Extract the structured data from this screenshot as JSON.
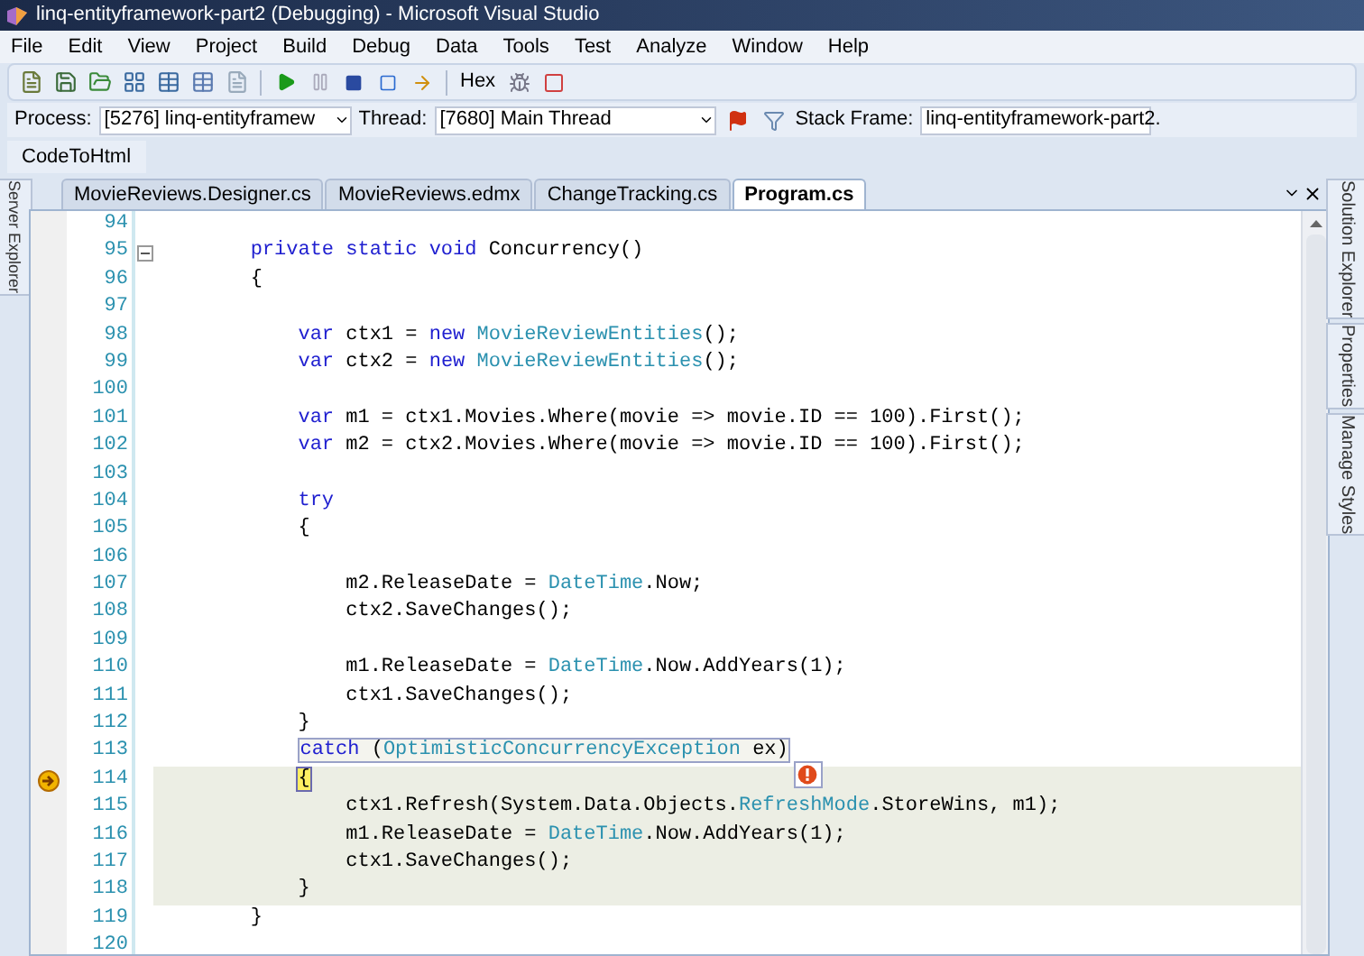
{
  "window": {
    "title": "linq-entityframework-part2 (Debugging) - Microsoft Visual Studio"
  },
  "menu": [
    "File",
    "Edit",
    "View",
    "Project",
    "Build",
    "Debug",
    "Data",
    "Tools",
    "Test",
    "Analyze",
    "Window",
    "Help"
  ],
  "toolbar": {
    "hex_button": "Hex"
  },
  "debug_bar": {
    "process_label": "Process:",
    "process": "[5276] linq-entityframew",
    "thread_label": "Thread:",
    "thread": "[7680] Main Thread",
    "stack_frame_label": "Stack Frame:",
    "stack_frame": "linq-entityframework-part2."
  },
  "code_to_html_bar": {
    "label": "CodeToHtml"
  },
  "left_dock": [
    "Server Explorer"
  ],
  "tabs": [
    {
      "label": "MovieReviews.Designer.cs",
      "selected": false
    },
    {
      "label": "MovieReviews.edmx",
      "selected": false
    },
    {
      "label": "ChangeTracking.cs",
      "selected": false
    },
    {
      "label": "Program.cs",
      "selected": true
    }
  ],
  "right_dock": [
    "Solution Explorer",
    "Properties",
    "Manage Styles"
  ],
  "editor": {
    "lines": [
      {
        "number": "94"
      },
      {
        "number": "95",
        "highlighted": false,
        "current": false,
        "collapsible": true,
        "boxed": false,
        "tokens": [
          {
            "text": "        private static void",
            "kind": "keyword"
          },
          {
            "text": " Concurrency()",
            "kind": "plain"
          }
        ]
      },
      {
        "number": "96",
        "highlighted": false,
        "current": false,
        "collapsible": false,
        "boxed": false,
        "tokens": [
          {
            "text": "        {",
            "kind": "plain"
          }
        ]
      },
      {
        "number": "97"
      },
      {
        "number": "98",
        "highlighted": false,
        "current": false,
        "collapsible": false,
        "boxed": false,
        "tokens": [
          {
            "text": "            var",
            "kind": "keyword"
          },
          {
            "text": " ctx1 = ",
            "kind": "plain"
          },
          {
            "text": "new",
            "kind": "keyword"
          },
          {
            "text": " MovieReviewEntities",
            "kind": "type"
          },
          {
            "text": "();",
            "kind": "plain"
          }
        ]
      },
      {
        "number": "99",
        "highlighted": false,
        "current": false,
        "collapsible": false,
        "boxed": false,
        "tokens": [
          {
            "text": "            var",
            "kind": "keyword"
          },
          {
            "text": " ctx2 = ",
            "kind": "plain"
          },
          {
            "text": "new",
            "kind": "keyword"
          },
          {
            "text": " MovieReviewEntities",
            "kind": "type"
          },
          {
            "text": "();",
            "kind": "plain"
          }
        ]
      },
      {
        "number": "100"
      },
      {
        "number": "101",
        "highlighted": false,
        "current": false,
        "collapsible": false,
        "boxed": false,
        "tokens": [
          {
            "text": "            var",
            "kind": "keyword"
          },
          {
            "text": " m1 = ctx1.Movies.Where(movie => movie.ID == 100).First();",
            "kind": "plain"
          }
        ]
      },
      {
        "number": "102",
        "highlighted": false,
        "current": false,
        "collapsible": false,
        "boxed": false,
        "tokens": [
          {
            "text": "            var",
            "kind": "keyword"
          },
          {
            "text": " m2 = ctx2.Movies.Where(movie => movie.ID == 100).First();",
            "kind": "plain"
          }
        ]
      },
      {
        "number": "103"
      },
      {
        "number": "104",
        "highlighted": false,
        "current": false,
        "collapsible": false,
        "boxed": false,
        "tokens": [
          {
            "text": "            try",
            "kind": "keyword"
          }
        ]
      },
      {
        "number": "105",
        "highlighted": false,
        "current": false,
        "collapsible": false,
        "boxed": false,
        "tokens": [
          {
            "text": "            {",
            "kind": "plain"
          }
        ]
      },
      {
        "number": "106"
      },
      {
        "number": "107",
        "highlighted": false,
        "current": false,
        "collapsible": false,
        "boxed": false,
        "tokens": [
          {
            "text": "                m2.ReleaseDate = ",
            "kind": "plain"
          },
          {
            "text": "DateTime",
            "kind": "type"
          },
          {
            "text": ".Now;",
            "kind": "plain"
          }
        ]
      },
      {
        "number": "108",
        "highlighted": false,
        "current": false,
        "collapsible": false,
        "boxed": false,
        "tokens": [
          {
            "text": "                ctx2.SaveChanges();",
            "kind": "plain"
          }
        ]
      },
      {
        "number": "109"
      },
      {
        "number": "110",
        "highlighted": false,
        "current": false,
        "collapsible": false,
        "boxed": false,
        "tokens": [
          {
            "text": "                m1.ReleaseDate = ",
            "kind": "plain"
          },
          {
            "text": "DateTime",
            "kind": "type"
          },
          {
            "text": ".Now.AddYears(1);",
            "kind": "plain"
          }
        ]
      },
      {
        "number": "111",
        "highlighted": false,
        "current": false,
        "collapsible": false,
        "boxed": false,
        "tokens": [
          {
            "text": "                ctx1.SaveChanges();",
            "kind": "plain"
          }
        ]
      },
      {
        "number": "112",
        "highlighted": false,
        "current": false,
        "collapsible": false,
        "boxed": false,
        "tokens": [
          {
            "text": "            }",
            "kind": "plain"
          }
        ]
      },
      {
        "number": "113",
        "highlighted": false,
        "current": false,
        "collapsible": false,
        "boxed": true,
        "tokens": [
          {
            "text": "            catch",
            "kind": "keyword"
          },
          {
            "text": " (",
            "kind": "plain"
          },
          {
            "text": "OptimisticConcurrencyException",
            "kind": "type"
          },
          {
            "text": " ex)",
            "kind": "plain"
          }
        ]
      },
      {
        "number": "114",
        "highlighted": true,
        "current": true,
        "collapsible": false,
        "boxed": false,
        "tokens": [
          {
            "text": "            {",
            "kind": "plain"
          }
        ]
      },
      {
        "number": "115",
        "highlighted": true,
        "current": false,
        "collapsible": false,
        "boxed": false,
        "tokens": [
          {
            "text": "                ctx1.Refresh(System.Data.Objects.",
            "kind": "plain"
          },
          {
            "text": "RefreshMode",
            "kind": "type"
          },
          {
            "text": ".StoreWins, m1);",
            "kind": "plain"
          }
        ]
      },
      {
        "number": "116",
        "highlighted": true,
        "current": false,
        "collapsible": false,
        "boxed": false,
        "tokens": [
          {
            "text": "                m1.ReleaseDate = ",
            "kind": "plain"
          },
          {
            "text": "DateTime",
            "kind": "type"
          },
          {
            "text": ".Now.AddYears(1);",
            "kind": "plain"
          }
        ]
      },
      {
        "number": "117",
        "highlighted": true,
        "current": false,
        "collapsible": false,
        "boxed": false,
        "tokens": [
          {
            "text": "                ctx1.SaveChanges();",
            "kind": "plain"
          }
        ]
      },
      {
        "number": "118",
        "highlighted": true,
        "current": false,
        "collapsible": false,
        "boxed": false,
        "tokens": [
          {
            "text": "            }",
            "kind": "plain"
          }
        ]
      },
      {
        "number": "119",
        "highlighted": false,
        "current": false,
        "collapsible": false,
        "boxed": false,
        "tokens": [
          {
            "text": "        }",
            "kind": "plain"
          }
        ]
      },
      {
        "number": "120"
      }
    ]
  }
}
